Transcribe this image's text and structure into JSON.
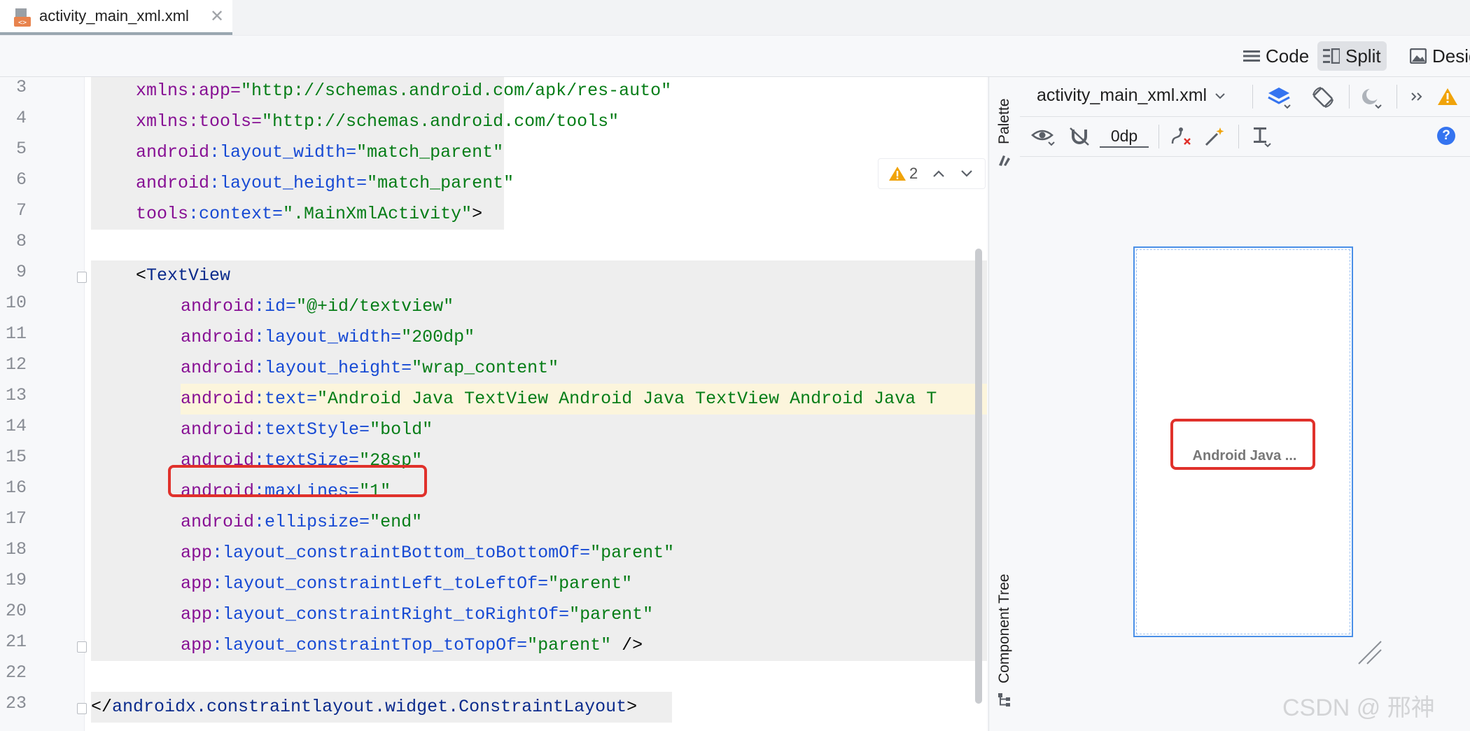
{
  "tab": {
    "file_name": "activity_main_xml.xml",
    "close": "✕"
  },
  "view_modes": {
    "code": "Code",
    "split": "Split",
    "design": "Design"
  },
  "editor": {
    "lines": [
      {
        "n": "3",
        "indent": 4,
        "tokens": [
          {
            "t": "xmlns:app=",
            "c": "c-ns"
          },
          {
            "t": "\"http://schemas.android.com/apk/res-auto\"",
            "c": "c-val"
          }
        ]
      },
      {
        "n": "4",
        "indent": 4,
        "tokens": [
          {
            "t": "xmlns:tools=",
            "c": "c-ns"
          },
          {
            "t": "\"http://schemas.android.com/tools\"",
            "c": "c-val"
          }
        ]
      },
      {
        "n": "5",
        "indent": 4,
        "tokens": [
          {
            "t": "android",
            "c": "c-ns"
          },
          {
            "t": ":layout_width=",
            "c": "c-attr"
          },
          {
            "t": "\"match_parent\"",
            "c": "c-val"
          }
        ]
      },
      {
        "n": "6",
        "indent": 4,
        "tokens": [
          {
            "t": "android",
            "c": "c-ns"
          },
          {
            "t": ":layout_height=",
            "c": "c-attr"
          },
          {
            "t": "\"match_parent\"",
            "c": "c-val"
          }
        ]
      },
      {
        "n": "7",
        "indent": 4,
        "tokens": [
          {
            "t": "tools",
            "c": "c-ns"
          },
          {
            "t": ":context=",
            "c": "c-attr"
          },
          {
            "t": "\".MainXmlActivity\"",
            "c": "c-val"
          },
          {
            "t": ">",
            "c": "c-plain"
          }
        ]
      },
      {
        "n": "8",
        "indent": 0,
        "tokens": []
      },
      {
        "n": "9",
        "indent": 4,
        "tokens": [
          {
            "t": "<",
            "c": "c-plain"
          },
          {
            "t": "TextView",
            "c": "c-tag"
          }
        ]
      },
      {
        "n": "10",
        "indent": 8,
        "tokens": [
          {
            "t": "android",
            "c": "c-ns"
          },
          {
            "t": ":id=",
            "c": "c-attr"
          },
          {
            "t": "\"@+id/textview\"",
            "c": "c-val"
          }
        ]
      },
      {
        "n": "11",
        "indent": 8,
        "tokens": [
          {
            "t": "android",
            "c": "c-ns"
          },
          {
            "t": ":layout_width=",
            "c": "c-attr"
          },
          {
            "t": "\"200dp\"",
            "c": "c-val"
          }
        ]
      },
      {
        "n": "12",
        "indent": 8,
        "tokens": [
          {
            "t": "android",
            "c": "c-ns"
          },
          {
            "t": ":layout_height=",
            "c": "c-attr"
          },
          {
            "t": "\"wrap_content\"",
            "c": "c-val"
          }
        ]
      },
      {
        "n": "13",
        "indent": 8,
        "tokens": [
          {
            "t": "android",
            "c": "c-ns"
          },
          {
            "t": ":text=",
            "c": "c-attr"
          },
          {
            "t": "\"Android Java TextView Android Java TextView Android Java T",
            "c": "c-val"
          }
        ]
      },
      {
        "n": "14",
        "indent": 8,
        "tokens": [
          {
            "t": "android",
            "c": "c-ns"
          },
          {
            "t": ":textStyle=",
            "c": "c-attr"
          },
          {
            "t": "\"bold\"",
            "c": "c-val"
          }
        ]
      },
      {
        "n": "15",
        "indent": 8,
        "tokens": [
          {
            "t": "android",
            "c": "c-ns"
          },
          {
            "t": ":textSize=",
            "c": "c-attr"
          },
          {
            "t": "\"28sp\"",
            "c": "c-val"
          }
        ]
      },
      {
        "n": "16",
        "indent": 8,
        "tokens": [
          {
            "t": "android",
            "c": "c-ns"
          },
          {
            "t": ":maxLines=",
            "c": "c-attr"
          },
          {
            "t": "\"1\"",
            "c": "c-val"
          }
        ]
      },
      {
        "n": "17",
        "indent": 8,
        "tokens": [
          {
            "t": "android",
            "c": "c-ns"
          },
          {
            "t": ":ellipsize=",
            "c": "c-attr"
          },
          {
            "t": "\"end\"",
            "c": "c-val"
          }
        ]
      },
      {
        "n": "18",
        "indent": 8,
        "tokens": [
          {
            "t": "app",
            "c": "c-ns"
          },
          {
            "t": ":layout_constraintBottom_toBottomOf=",
            "c": "c-attr"
          },
          {
            "t": "\"parent\"",
            "c": "c-val"
          }
        ]
      },
      {
        "n": "19",
        "indent": 8,
        "tokens": [
          {
            "t": "app",
            "c": "c-ns"
          },
          {
            "t": ":layout_constraintLeft_toLeftOf=",
            "c": "c-attr"
          },
          {
            "t": "\"parent\"",
            "c": "c-val"
          }
        ]
      },
      {
        "n": "20",
        "indent": 8,
        "tokens": [
          {
            "t": "app",
            "c": "c-ns"
          },
          {
            "t": ":layout_constraintRight_toRightOf=",
            "c": "c-attr"
          },
          {
            "t": "\"parent\"",
            "c": "c-val"
          }
        ]
      },
      {
        "n": "21",
        "indent": 8,
        "tokens": [
          {
            "t": "app",
            "c": "c-ns"
          },
          {
            "t": ":layout_constraintTop_toTopOf=",
            "c": "c-attr"
          },
          {
            "t": "\"parent\"",
            "c": "c-val"
          },
          {
            "t": " />",
            "c": "c-plain"
          }
        ]
      },
      {
        "n": "22",
        "indent": 0,
        "tokens": []
      },
      {
        "n": "23",
        "indent": 0,
        "tokens": [
          {
            "t": "</",
            "c": "c-plain"
          },
          {
            "t": "androidx.constraintlayout.widget.ConstraintLayout",
            "c": "c-tag"
          },
          {
            "t": ">",
            "c": "c-plain"
          }
        ]
      }
    ],
    "warning_count": "2"
  },
  "side_strip": {
    "palette": "Palette",
    "component_tree": "Component Tree"
  },
  "design": {
    "file_selector": "activity_main_xml.xml",
    "margin_value": "0dp",
    "preview_text": "Android Java ...",
    "help": "?"
  },
  "watermark": "CSDN @ 邢神",
  "icons": {
    "warning": "warning-icon",
    "eye": "eye-icon",
    "magnet": "magnet-icon",
    "wand": "magic-wand-icon"
  }
}
